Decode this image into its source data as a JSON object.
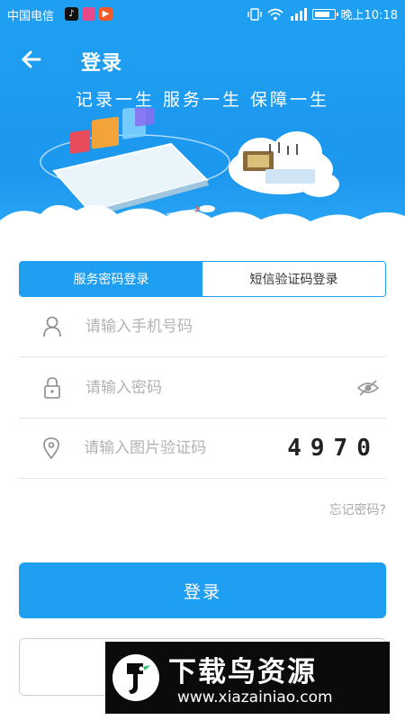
{
  "status_bar": {
    "carrier": "中国电信",
    "time": "晚上10:18"
  },
  "header": {
    "title": "登录",
    "slogan": "记录一生  服务一生  保障一生",
    "back_icon": "arrow-left-icon"
  },
  "tabs": [
    {
      "label": "服务密码登录",
      "active": true
    },
    {
      "label": "短信验证码登录",
      "active": false
    }
  ],
  "form": {
    "phone": {
      "placeholder": "请输入手机号码",
      "value": "",
      "icon": "user-icon"
    },
    "password": {
      "placeholder": "请输入密码",
      "value": "",
      "icon": "lock-icon",
      "toggle_icon": "eye-off-icon"
    },
    "captcha": {
      "placeholder": "请输入图片验证码",
      "value": "",
      "icon": "location-pin-icon",
      "code": "4970"
    }
  },
  "forgot_label": "忘记密码?",
  "login_label": "登录",
  "colors": {
    "primary": "#1e9ff2",
    "placeholder": "#b3b3b3",
    "watermark_bg": "#0b0b0b"
  },
  "watermark": {
    "title": "下载鸟资源",
    "url": "www.xiazainiao.com"
  }
}
